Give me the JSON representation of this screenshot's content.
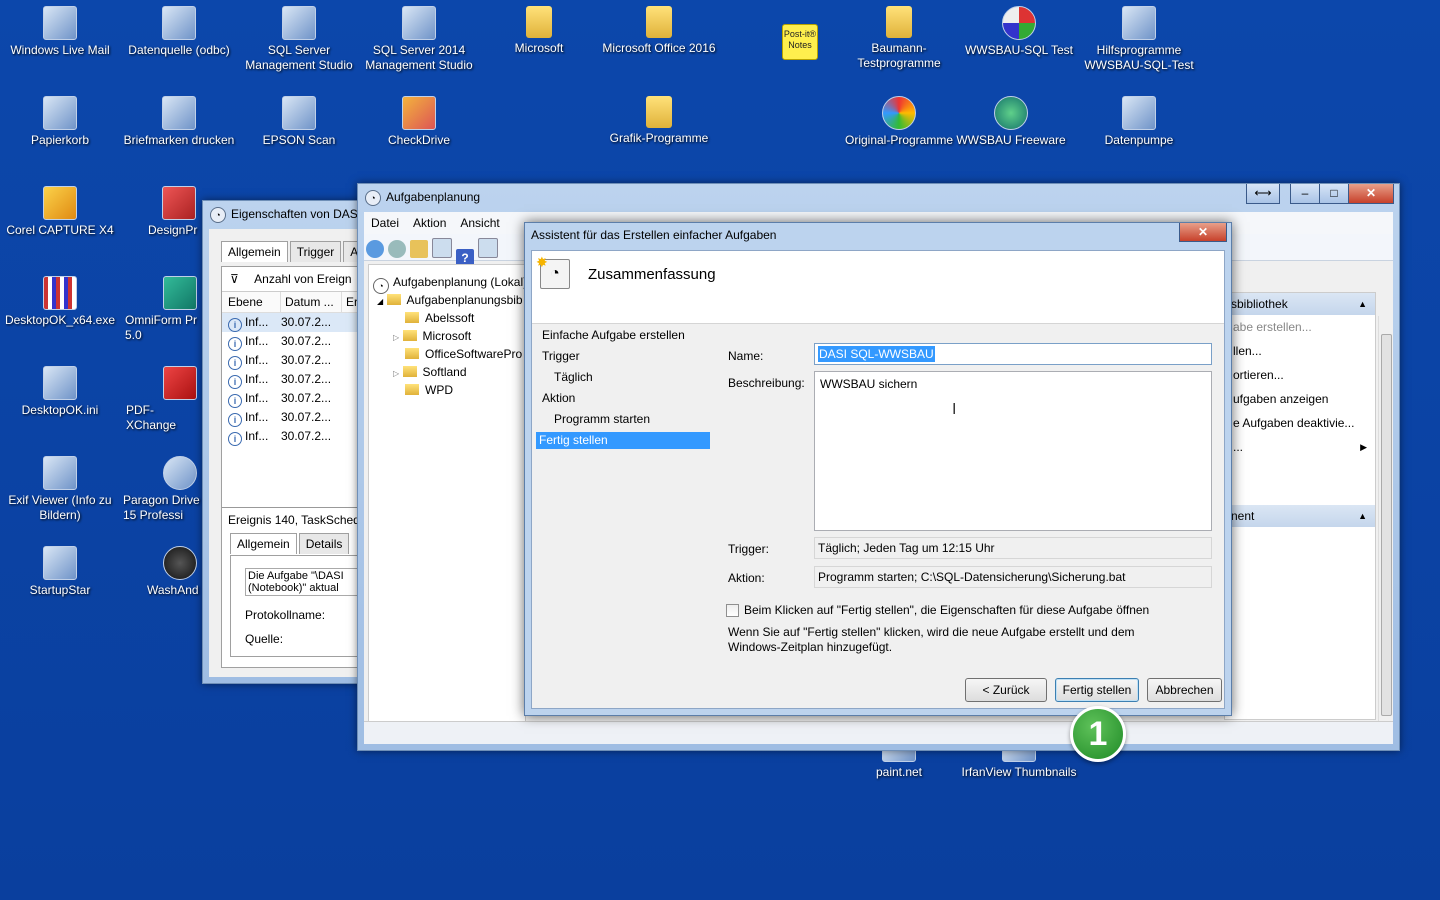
{
  "desktop": {
    "icons_row1": [
      "Windows Live Mail",
      "Datenquelle (odbc)",
      "SQL Server Management Studio",
      "SQL Server 2014 Management Studio",
      "Microsoft",
      "Microsoft Office 2016",
      "",
      "Baumann-Testprogramme",
      "WWSBAU-SQL  Test",
      "Hilfsprogramme WWSBAU-SQL-Test"
    ],
    "icons_row2": [
      "Papierkorb",
      "Briefmarken drucken",
      "EPSON Scan",
      "CheckDrive",
      "Grafik-Programme",
      "Original-Programme",
      "WWSBAU Freeware",
      "Datenpumpe"
    ],
    "icons_col": [
      "Corel CAPTURE X4",
      "DesignPr",
      "DesktopOK_x64.exe",
      "OmniForm Pr 5.0",
      "DesktopOK.ini",
      "PDF-XChange",
      "Exif Viewer (Info zu Bildern)",
      "Paragon Drive 15 Professi",
      "StartupStar",
      "WashAnd"
    ],
    "icons_bottom": [
      "paint.net",
      "IrfanView Thumbnails"
    ],
    "postit_label": "Post-it® Notes"
  },
  "props_window": {
    "title": "Eigenschaften von DASI",
    "tabs": [
      "Allgemein",
      "Trigger",
      "Ak"
    ],
    "filter_label": "Anzahl von Ereign",
    "columns": [
      "Ebene",
      "Datum ...",
      "Er"
    ],
    "rows": [
      {
        "level": "Inf...",
        "date": "30.07.2..."
      },
      {
        "level": "Inf...",
        "date": "30.07.2..."
      },
      {
        "level": "Inf...",
        "date": "30.07.2..."
      },
      {
        "level": "Inf...",
        "date": "30.07.2..."
      },
      {
        "level": "Inf...",
        "date": "30.07.2..."
      },
      {
        "level": "Inf...",
        "date": "30.07.2..."
      },
      {
        "level": "Inf...",
        "date": "30.07.2..."
      }
    ],
    "event_header": "Ereignis 140, TaskSchedu",
    "detail_tabs": [
      "Allgemein",
      "Details"
    ],
    "detail_text": "Die Aufgabe \"\\DASI (Notebook)\" aktual",
    "protocol_label": "Protokollname:",
    "source_label": "Quelle:"
  },
  "scheduler": {
    "title": "Aufgabenplanung",
    "menu": [
      "Datei",
      "Aktion",
      "Ansicht"
    ],
    "tree": {
      "root": "Aufgabenplanung (Lokal)",
      "library": "Aufgabenplanungsbib",
      "children": [
        "Abelssoft",
        "Microsoft",
        "OfficeSoftwarePro",
        "Softland",
        "WPD"
      ]
    },
    "right_panel": {
      "header1": "sbibliothek",
      "items": [
        "abe erstellen...",
        "llen...",
        "ortieren...",
        "ufgaben anzeigen",
        "e Aufgaben deaktivie...",
        "..."
      ],
      "header2": "nent"
    }
  },
  "wizard": {
    "title": "Assistent für das Erstellen einfacher Aufgaben",
    "heading": "Zusammenfassung",
    "nav": [
      {
        "label": "Einfache Aufgabe erstellen",
        "indent": false,
        "selected": false
      },
      {
        "label": "Trigger",
        "indent": false,
        "selected": false
      },
      {
        "label": "Täglich",
        "indent": true,
        "selected": false
      },
      {
        "label": "Aktion",
        "indent": false,
        "selected": false
      },
      {
        "label": "Programm starten",
        "indent": true,
        "selected": false
      },
      {
        "label": "Fertig stellen",
        "indent": false,
        "selected": true
      }
    ],
    "name_label": "Name:",
    "name_value": "DASI SQL-WWSBAU",
    "description_label": "Beschreibung:",
    "description_value": "WWSBAU sichern",
    "trigger_label": "Trigger:",
    "trigger_value": "Täglich; Jeden Tag um 12:15 Uhr",
    "action_label": "Aktion:",
    "action_value": "Programm starten; C:\\SQL-Datensicherung\\Sicherung.bat",
    "checkbox_label": "Beim Klicken auf \"Fertig stellen\", die Eigenschaften für diese Aufgabe öffnen",
    "info_text": "Wenn Sie auf \"Fertig stellen\" klicken, wird die neue Aufgabe erstellt und dem Windows-Zeitplan hinzugefügt.",
    "buttons": {
      "back": "< Zurück",
      "finish": "Fertig stellen",
      "cancel": "Abbrechen"
    }
  },
  "annotation": {
    "number": "1",
    "color": "#2e9b31"
  }
}
